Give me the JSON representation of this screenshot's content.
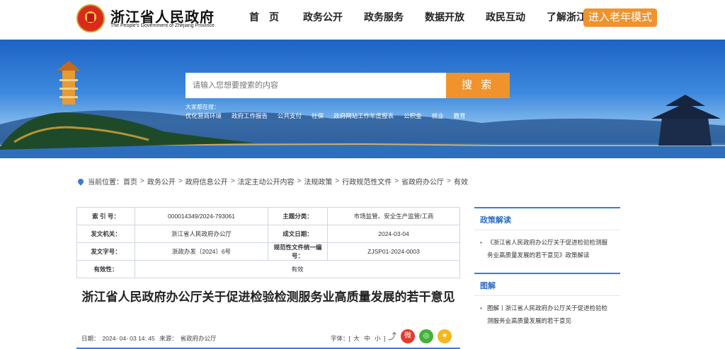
{
  "header": {
    "site_title": "浙江省人民政府",
    "site_subtitle": "The People's Government of Zhejiang Province",
    "nav": [
      "首页",
      "政务公开",
      "政务服务",
      "数据开放",
      "政民互动",
      "了解浙江"
    ],
    "elder_mode": "进入老年模式",
    "accent_color": "#f0932c"
  },
  "banner": {
    "search_placeholder": "请输入您想要搜索的内容",
    "search_button": "搜 索",
    "hot_label": "大家都在搜：",
    "hot_links": [
      "优化营商环境",
      "政府工作报告",
      "公共支付",
      "社保",
      "政府网站工作年度报表",
      "公积金",
      "就业",
      "教育"
    ]
  },
  "breadcrumb": {
    "prefix": "当前位置：",
    "items": [
      "首页",
      "政务公开",
      "政府信息公开",
      "法定主动公开内容",
      "法规政策",
      "行政规范性文件",
      "省政府办公厅",
      "有效"
    ],
    "separator": ">"
  },
  "info": {
    "index_label": "索 引 号：",
    "index_value": "000014349/2024-793061",
    "category_label": "主题分类：",
    "category_value": "市场监管、安全生产监管/工商",
    "issuer_label": "发文机关：",
    "issuer_value": "浙江省人民政府办公厅",
    "date_label": "成文日期：",
    "date_value": "2024-03-04",
    "doc_no_label": "发文字号：",
    "doc_no_value": "浙政办发〔2024〕6号",
    "norm_no_label": "规范性文件统一编号：",
    "norm_no_value": "ZJSP01-2024-0003",
    "validity_label": "有效性：",
    "validity_value": "有效"
  },
  "article": {
    "title": "浙江省人民政府办公厅关于促进检验检测服务业高质量发展的若干意见",
    "date_label": "日期：",
    "date_value": "2024- 04- 03 14: 45",
    "source_label": "来源：",
    "source_value": "省政府办公厅",
    "font_label": "字体：[",
    "font_options": [
      "大",
      "中",
      "小"
    ],
    "font_close": "]"
  },
  "sidebar": {
    "policy_title": "政策解读",
    "policy_item": "《浙江省人民政府办公厅关于促进检验检测服务业高质量发展的若干意见》政策解读",
    "graphic_title": "图解",
    "graphic_item": "图解丨浙江省人民政府办公厅关于促进检验检测服务业高质量发展的若干意见"
  }
}
